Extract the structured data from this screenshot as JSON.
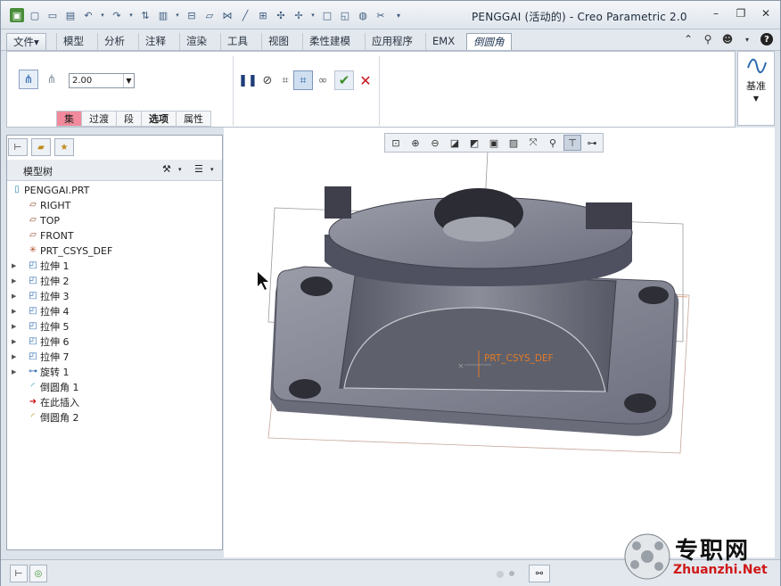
{
  "window": {
    "title": "PENGGAI (活动的) - Creo Parametric 2.0"
  },
  "ribbon_tabs": [
    {
      "label": "文件▾"
    },
    {
      "label": "模型"
    },
    {
      "label": "分析"
    },
    {
      "label": "注释"
    },
    {
      "label": "渲染"
    },
    {
      "label": "工具"
    },
    {
      "label": "视图"
    },
    {
      "label": "柔性建模"
    },
    {
      "label": "应用程序"
    },
    {
      "label": "EMX"
    },
    {
      "label": "倒圆角"
    }
  ],
  "ribbon": {
    "radius_value": "2.00",
    "datum_label": "基准",
    "subtabs": [
      "集",
      "过渡",
      "段",
      "选项",
      "属性"
    ]
  },
  "panel": {
    "title": "模型树"
  },
  "tree": [
    {
      "label": "PENGGAI.PRT",
      "icon": "part-icon",
      "expandable": false,
      "indent": 0
    },
    {
      "label": "RIGHT",
      "icon": "datum-plane-icon",
      "expandable": false,
      "indent": 1
    },
    {
      "label": "TOP",
      "icon": "datum-plane-icon",
      "expandable": false,
      "indent": 1
    },
    {
      "label": "FRONT",
      "icon": "datum-plane-icon",
      "expandable": false,
      "indent": 1
    },
    {
      "label": "PRT_CSYS_DEF",
      "icon": "csys-icon",
      "expandable": false,
      "indent": 1
    },
    {
      "label": "拉伸 1",
      "icon": "extrude-icon",
      "expandable": true,
      "indent": 1
    },
    {
      "label": "拉伸 2",
      "icon": "extrude-icon",
      "expandable": true,
      "indent": 1
    },
    {
      "label": "拉伸 3",
      "icon": "extrude-icon",
      "expandable": true,
      "indent": 1
    },
    {
      "label": "拉伸 4",
      "icon": "extrude-icon",
      "expandable": true,
      "indent": 1
    },
    {
      "label": "拉伸 5",
      "icon": "extrude-icon",
      "expandable": true,
      "indent": 1
    },
    {
      "label": "拉伸 6",
      "icon": "extrude-icon",
      "expandable": true,
      "indent": 1
    },
    {
      "label": "拉伸 7",
      "icon": "extrude-icon",
      "expandable": true,
      "indent": 1
    },
    {
      "label": "旋转 1",
      "icon": "revolve-icon",
      "expandable": true,
      "indent": 1
    },
    {
      "label": "倒圆角 1",
      "icon": "round-icon",
      "expandable": false,
      "indent": 1
    },
    {
      "label": "在此插入",
      "icon": "insert-here-icon",
      "expandable": false,
      "indent": 1
    },
    {
      "label": "倒圆角 2",
      "icon": "round-active-icon",
      "expandable": false,
      "indent": 1
    }
  ],
  "graphics": {
    "csys_label": "PRT_CSYS_DEF"
  },
  "watermark": {
    "cn": "专职网",
    "en": "Zhuanzhi.Net"
  }
}
